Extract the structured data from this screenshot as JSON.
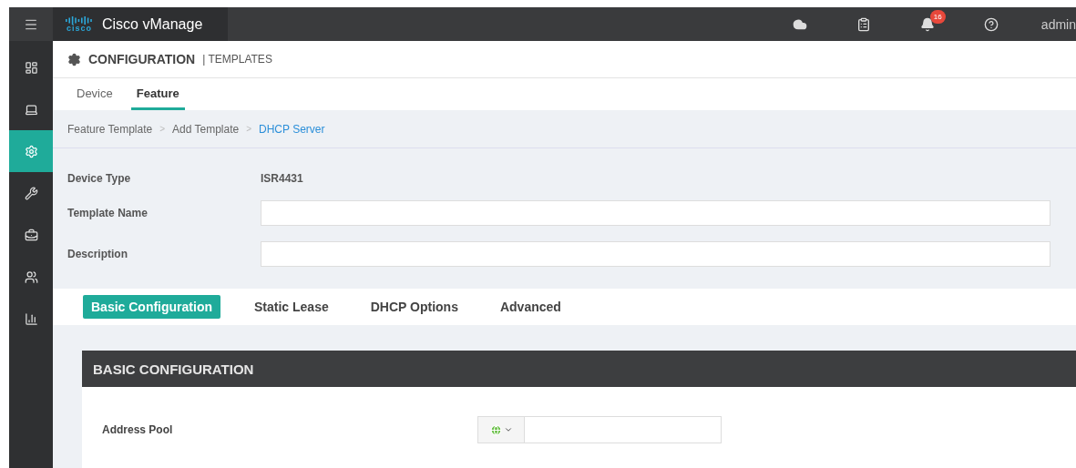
{
  "topbar": {
    "logo_word": "cisco",
    "product": "Cisco vManage",
    "notifications": "16",
    "user": "admin"
  },
  "sidebar": {
    "items": [
      {
        "kind": "dashboard",
        "selected": false
      },
      {
        "kind": "monitor",
        "selected": false
      },
      {
        "kind": "configuration",
        "selected": true
      },
      {
        "kind": "tools",
        "selected": false
      },
      {
        "kind": "maintenance",
        "selected": false
      },
      {
        "kind": "administration",
        "selected": false
      },
      {
        "kind": "analytics",
        "selected": false
      }
    ]
  },
  "header": {
    "title": "CONFIGURATION",
    "subtitle": "| TEMPLATES"
  },
  "tabs": [
    {
      "label": "Device",
      "selected": false
    },
    {
      "label": "Feature",
      "selected": true
    }
  ],
  "breadcrumb": [
    {
      "label": "Feature Template",
      "current": false
    },
    {
      "label": "Add Template",
      "current": false
    },
    {
      "label": "DHCP Server",
      "current": true
    }
  ],
  "breadcrumb_separator": ">",
  "form": {
    "device_type_label": "Device Type",
    "device_type": "ISR4431",
    "template_name_label": "Template Name",
    "description_label": "Description"
  },
  "section_tabs": [
    {
      "label": "Basic Configuration",
      "selected": true
    },
    {
      "label": "Static Lease",
      "selected": false
    },
    {
      "label": "DHCP Options",
      "selected": false
    },
    {
      "label": "Advanced",
      "selected": false
    }
  ],
  "section": {
    "title": "BASIC CONFIGURATION",
    "fields": [
      {
        "label": "Address Pool"
      }
    ]
  }
}
